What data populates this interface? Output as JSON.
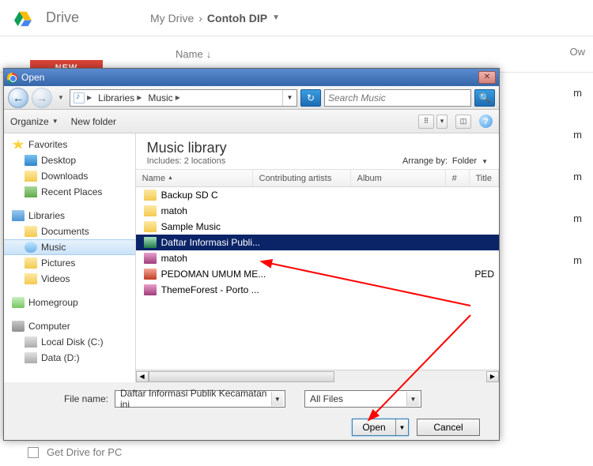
{
  "drive": {
    "title": "Drive",
    "breadcrumb_root": "My Drive",
    "breadcrumb_sep": "›",
    "breadcrumb_leaf": "Contoh DIP",
    "name_col": "Name",
    "owner_col": "Ow",
    "new_btn": "NEW",
    "rows": [
      "m",
      "m",
      "m",
      "m",
      "m"
    ],
    "get_drive": "Get Drive for PC"
  },
  "dialog": {
    "title": "Open",
    "close_glyph": "✕",
    "nav_back": "←",
    "nav_fwd": "→",
    "path": {
      "root": "Libraries",
      "leaf": "Music"
    },
    "refresh_glyph": "↻",
    "search_placeholder": "Search Music",
    "search_glyph": "🔍",
    "toolbar": {
      "organize": "Organize",
      "new_folder": "New folder",
      "help_glyph": "?"
    },
    "sidebar": {
      "favorites": {
        "label": "Favorites",
        "items": [
          "Desktop",
          "Downloads",
          "Recent Places"
        ]
      },
      "libraries": {
        "label": "Libraries",
        "items": [
          "Documents",
          "Music",
          "Pictures",
          "Videos"
        ]
      },
      "homegroup": "Homegroup",
      "computer": {
        "label": "Computer",
        "items": [
          "Local Disk (C:)",
          "Data (D:)"
        ]
      }
    },
    "content": {
      "title": "Music library",
      "subtitle": "Includes:  2 locations",
      "arrange_label": "Arrange by:",
      "arrange_value": "Folder",
      "cols": {
        "name": "Name",
        "contrib": "Contributing artists",
        "album": "Album",
        "hash": "#",
        "title": "Title"
      },
      "files": [
        {
          "name": "Backup SD C",
          "type": "folder",
          "title": ""
        },
        {
          "name": "matoh",
          "type": "folder",
          "title": ""
        },
        {
          "name": "Sample Music",
          "type": "folder",
          "title": ""
        },
        {
          "name": "Daftar Informasi Publi...",
          "type": "xlsx",
          "title": "",
          "selected": true
        },
        {
          "name": "matoh",
          "type": "rar",
          "title": ""
        },
        {
          "name": "PEDOMAN UMUM ME...",
          "type": "pdf",
          "title": "PED"
        },
        {
          "name": "ThemeForest - Porto ...",
          "type": "rar",
          "title": ""
        }
      ]
    },
    "footer": {
      "fn_label": "File name:",
      "fn_value": "Daftar Informasi Publik Kecamatan ini",
      "filter": "All Files",
      "open": "Open",
      "cancel": "Cancel"
    }
  }
}
